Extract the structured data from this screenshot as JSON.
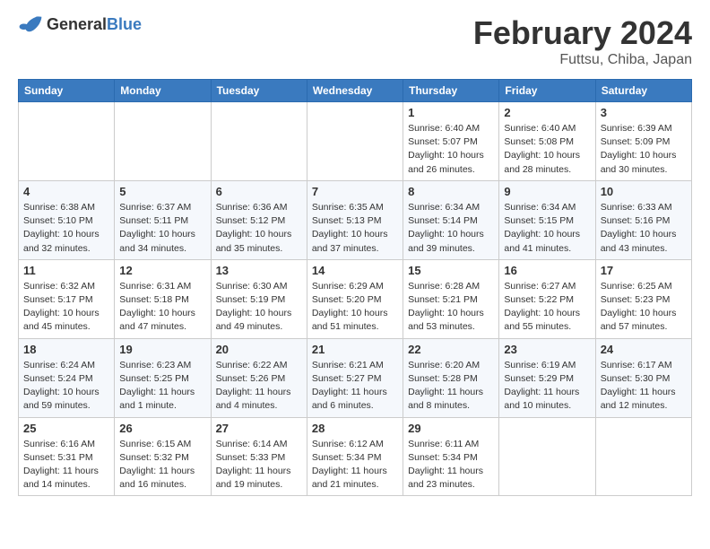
{
  "header": {
    "logo_general": "General",
    "logo_blue": "Blue",
    "title": "February 2024",
    "subtitle": "Futtsu, Chiba, Japan"
  },
  "days_of_week": [
    "Sunday",
    "Monday",
    "Tuesday",
    "Wednesday",
    "Thursday",
    "Friday",
    "Saturday"
  ],
  "weeks": [
    [
      {
        "day": "",
        "info": ""
      },
      {
        "day": "",
        "info": ""
      },
      {
        "day": "",
        "info": ""
      },
      {
        "day": "",
        "info": ""
      },
      {
        "day": "1",
        "info": "Sunrise: 6:40 AM\nSunset: 5:07 PM\nDaylight: 10 hours\nand 26 minutes."
      },
      {
        "day": "2",
        "info": "Sunrise: 6:40 AM\nSunset: 5:08 PM\nDaylight: 10 hours\nand 28 minutes."
      },
      {
        "day": "3",
        "info": "Sunrise: 6:39 AM\nSunset: 5:09 PM\nDaylight: 10 hours\nand 30 minutes."
      }
    ],
    [
      {
        "day": "4",
        "info": "Sunrise: 6:38 AM\nSunset: 5:10 PM\nDaylight: 10 hours\nand 32 minutes."
      },
      {
        "day": "5",
        "info": "Sunrise: 6:37 AM\nSunset: 5:11 PM\nDaylight: 10 hours\nand 34 minutes."
      },
      {
        "day": "6",
        "info": "Sunrise: 6:36 AM\nSunset: 5:12 PM\nDaylight: 10 hours\nand 35 minutes."
      },
      {
        "day": "7",
        "info": "Sunrise: 6:35 AM\nSunset: 5:13 PM\nDaylight: 10 hours\nand 37 minutes."
      },
      {
        "day": "8",
        "info": "Sunrise: 6:34 AM\nSunset: 5:14 PM\nDaylight: 10 hours\nand 39 minutes."
      },
      {
        "day": "9",
        "info": "Sunrise: 6:34 AM\nSunset: 5:15 PM\nDaylight: 10 hours\nand 41 minutes."
      },
      {
        "day": "10",
        "info": "Sunrise: 6:33 AM\nSunset: 5:16 PM\nDaylight: 10 hours\nand 43 minutes."
      }
    ],
    [
      {
        "day": "11",
        "info": "Sunrise: 6:32 AM\nSunset: 5:17 PM\nDaylight: 10 hours\nand 45 minutes."
      },
      {
        "day": "12",
        "info": "Sunrise: 6:31 AM\nSunset: 5:18 PM\nDaylight: 10 hours\nand 47 minutes."
      },
      {
        "day": "13",
        "info": "Sunrise: 6:30 AM\nSunset: 5:19 PM\nDaylight: 10 hours\nand 49 minutes."
      },
      {
        "day": "14",
        "info": "Sunrise: 6:29 AM\nSunset: 5:20 PM\nDaylight: 10 hours\nand 51 minutes."
      },
      {
        "day": "15",
        "info": "Sunrise: 6:28 AM\nSunset: 5:21 PM\nDaylight: 10 hours\nand 53 minutes."
      },
      {
        "day": "16",
        "info": "Sunrise: 6:27 AM\nSunset: 5:22 PM\nDaylight: 10 hours\nand 55 minutes."
      },
      {
        "day": "17",
        "info": "Sunrise: 6:25 AM\nSunset: 5:23 PM\nDaylight: 10 hours\nand 57 minutes."
      }
    ],
    [
      {
        "day": "18",
        "info": "Sunrise: 6:24 AM\nSunset: 5:24 PM\nDaylight: 10 hours\nand 59 minutes."
      },
      {
        "day": "19",
        "info": "Sunrise: 6:23 AM\nSunset: 5:25 PM\nDaylight: 11 hours\nand 1 minute."
      },
      {
        "day": "20",
        "info": "Sunrise: 6:22 AM\nSunset: 5:26 PM\nDaylight: 11 hours\nand 4 minutes."
      },
      {
        "day": "21",
        "info": "Sunrise: 6:21 AM\nSunset: 5:27 PM\nDaylight: 11 hours\nand 6 minutes."
      },
      {
        "day": "22",
        "info": "Sunrise: 6:20 AM\nSunset: 5:28 PM\nDaylight: 11 hours\nand 8 minutes."
      },
      {
        "day": "23",
        "info": "Sunrise: 6:19 AM\nSunset: 5:29 PM\nDaylight: 11 hours\nand 10 minutes."
      },
      {
        "day": "24",
        "info": "Sunrise: 6:17 AM\nSunset: 5:30 PM\nDaylight: 11 hours\nand 12 minutes."
      }
    ],
    [
      {
        "day": "25",
        "info": "Sunrise: 6:16 AM\nSunset: 5:31 PM\nDaylight: 11 hours\nand 14 minutes."
      },
      {
        "day": "26",
        "info": "Sunrise: 6:15 AM\nSunset: 5:32 PM\nDaylight: 11 hours\nand 16 minutes."
      },
      {
        "day": "27",
        "info": "Sunrise: 6:14 AM\nSunset: 5:33 PM\nDaylight: 11 hours\nand 19 minutes."
      },
      {
        "day": "28",
        "info": "Sunrise: 6:12 AM\nSunset: 5:34 PM\nDaylight: 11 hours\nand 21 minutes."
      },
      {
        "day": "29",
        "info": "Sunrise: 6:11 AM\nSunset: 5:34 PM\nDaylight: 11 hours\nand 23 minutes."
      },
      {
        "day": "",
        "info": ""
      },
      {
        "day": "",
        "info": ""
      }
    ]
  ]
}
